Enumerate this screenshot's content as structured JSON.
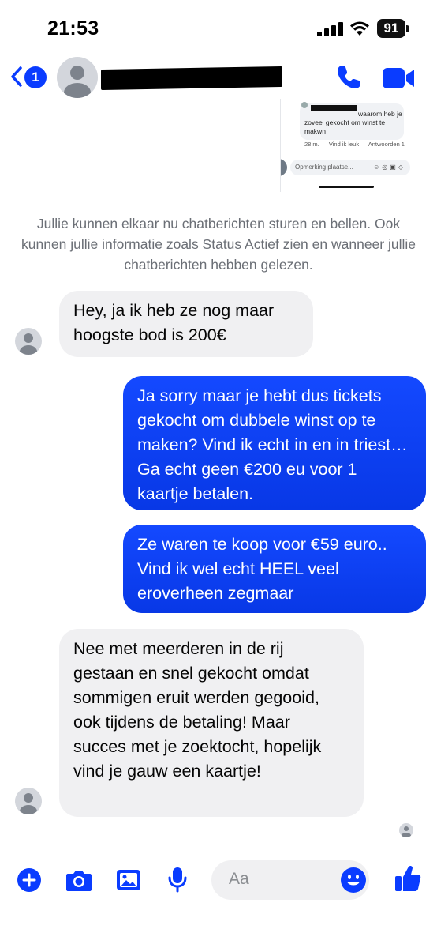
{
  "status_bar": {
    "time": "21:53",
    "battery": "91"
  },
  "header": {
    "back_badge": "1"
  },
  "embedded_screenshot": {
    "comment_text": "waarom heb je zoveel gekocht om winst te makwn",
    "time": "28 m.",
    "like": "Vind ik leuk",
    "reply": "Antwoorden",
    "reaction_count": "1",
    "input_placeholder": "Opmerking plaatse..."
  },
  "info_text": "Jullie kunnen elkaar nu chatberichten sturen en bellen. Ook kunnen jullie informatie zoals Status Actief zien en wanneer jullie chatberichten hebben gelezen.",
  "messages": [
    {
      "direction": "incoming",
      "text": "Hey, ja ik heb ze nog maar hoogste bod is 200€"
    },
    {
      "direction": "outgoing",
      "text": "Ja sorry maar je hebt dus tickets gekocht om dubbele winst op te maken? Vind ik echt in en in triest… Ga echt geen €200 eu voor 1 kaartje betalen."
    },
    {
      "direction": "outgoing",
      "text": "Ze waren te koop voor €59 euro.. Vind ik wel echt HEEL veel eroverheen zegmaar"
    },
    {
      "direction": "incoming",
      "text": "Nee met meerderen in de rij gestaan en snel gekocht omdat sommigen eruit werden gegooid, ook tijdens de betaling! Maar succes met je zoektocht, hopelijk vind je gauw een kaartje!"
    }
  ],
  "composer": {
    "placeholder": "Aa"
  },
  "colors": {
    "accent": "#0a3cff",
    "incoming_bubble": "#f0f0f2",
    "outgoing_bubble": "#1449ff"
  }
}
